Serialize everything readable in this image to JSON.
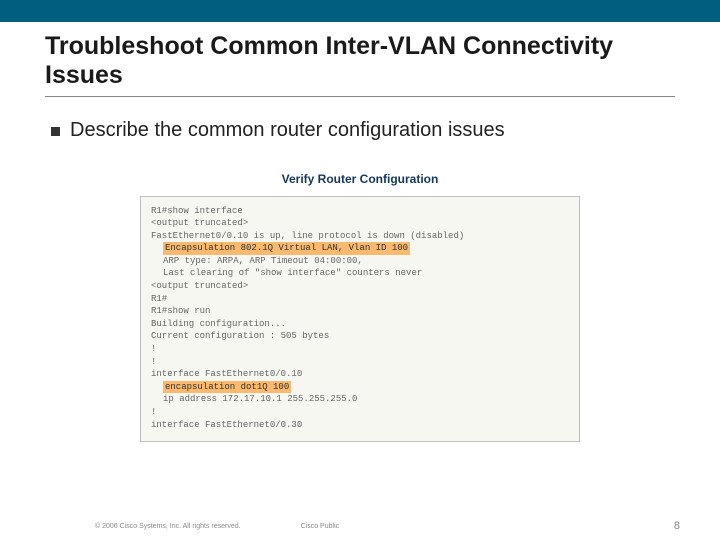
{
  "header": {
    "title": "Troubleshoot Common Inter-VLAN Connectivity Issues"
  },
  "bullet": {
    "text": "Describe the common router configuration issues"
  },
  "figure": {
    "title": "Verify Router Configuration",
    "lines": {
      "l1": "R1#show interface",
      "l2": "<output truncated>",
      "l3": "FastEthernet0/0.10 is up, line protocol is down (disabled)",
      "l4": "Encapsulation 802.1Q Virtual LAN, Vlan ID 100",
      "l5": "ARP type: ARPA, ARP Timeout 04:00:00,",
      "l6": "Last clearing of \"show interface\" counters never",
      "l7": "<output truncated>",
      "l8": "R1#",
      "l9": "R1#show run",
      "l10": "Building configuration...",
      "l11": "Current configuration : 505 bytes",
      "l12": "!",
      "l13": "!",
      "l14": "interface FastEthernet0/0.10",
      "l15": "encapsulation dot1Q 100",
      "l16": "ip address 172.17.10.1 255.255.255.0",
      "l17": "!",
      "l18": "interface FastEthernet0/0.30"
    }
  },
  "footer": {
    "copyright": "© 2006 Cisco Systems, Inc. All rights reserved.",
    "publicity": "Cisco Public",
    "page": "8"
  }
}
